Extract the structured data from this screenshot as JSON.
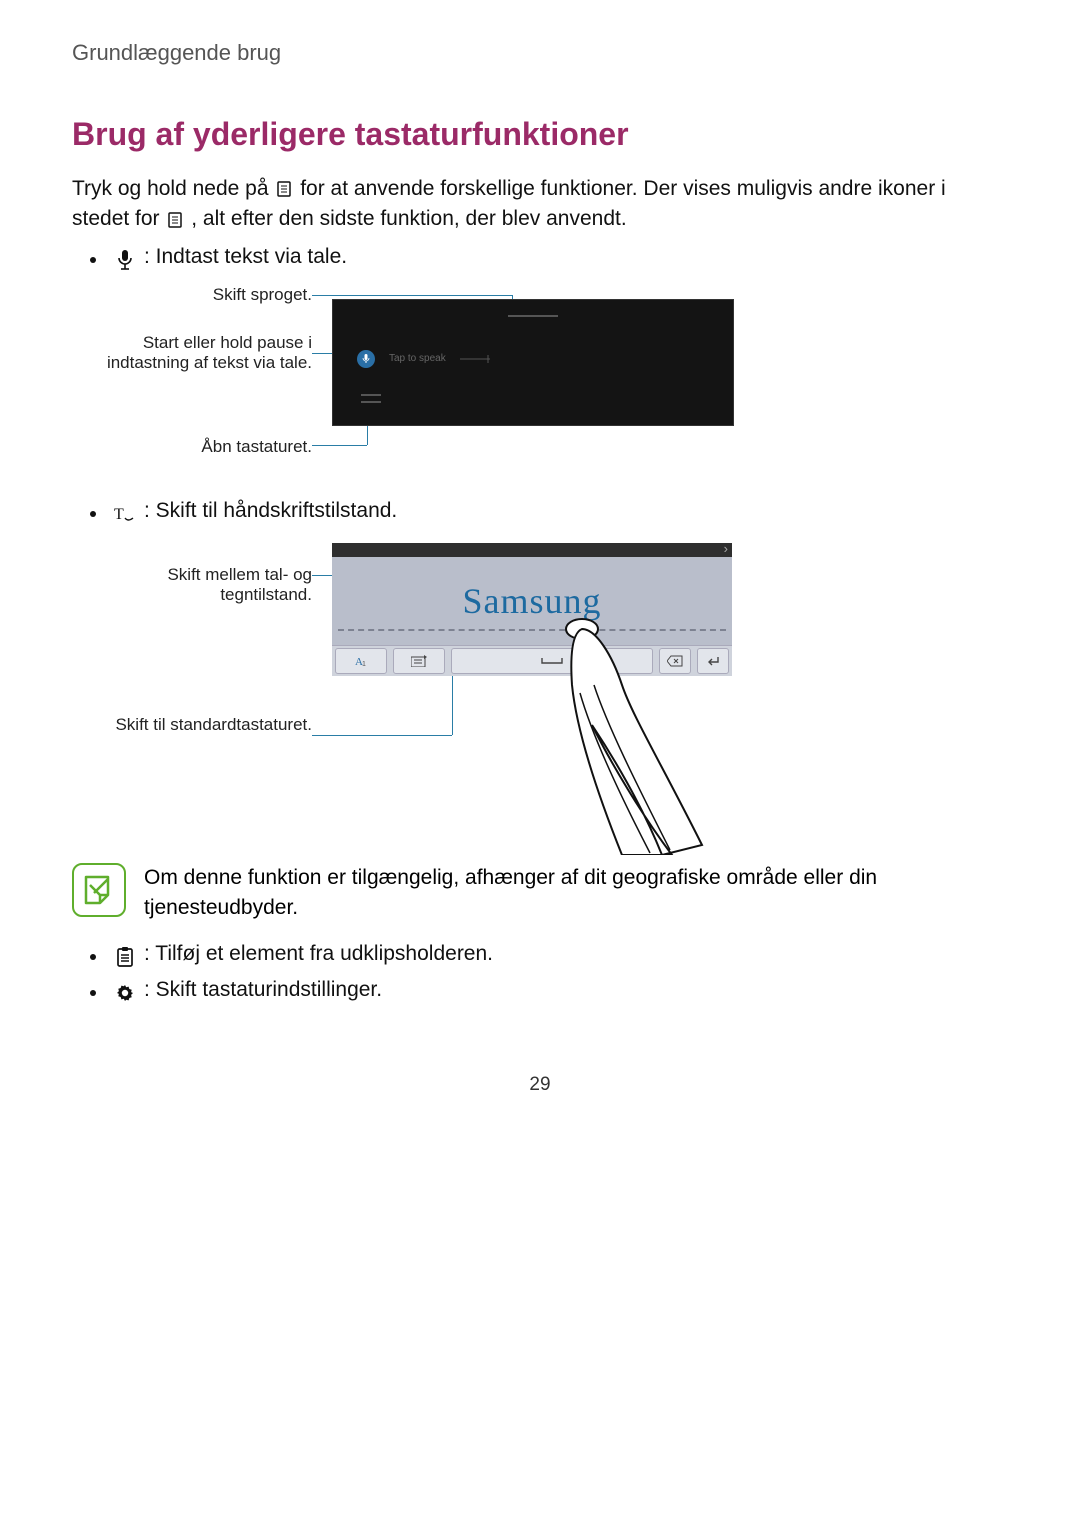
{
  "breadcrumb": "Grundlæggende brug",
  "heading": "Brug af yderligere tastaturfunktioner",
  "intro_a": "Tryk og hold nede på ",
  "intro_b": " for at anvende forskellige funktioner. Der vises muligvis andre ikoner i stedet for ",
  "intro_c": ", alt efter den sidste funktion, der blev anvendt.",
  "bullets": {
    "voice": " : Indtast tekst via tale.",
    "handwriting": " : Skift til håndskriftstilstand.",
    "clipboard": " : Tilføj et element fra udklipsholderen.",
    "settings": " : Skift tastaturindstillinger."
  },
  "fig1": {
    "callout_lang": "Skift sproget.",
    "callout_pause": "Start eller hold pause i indtastning af tekst via tale.",
    "callout_keyboard": "Åbn tastaturet.",
    "tap_prompt": "Tap to speak"
  },
  "fig2": {
    "callout_toggle": "Skift mellem tal- og tegntilstand.",
    "callout_std": "Skift til standardtastaturet.",
    "sample_text": "Samsung"
  },
  "note": "Om denne funktion er tilgængelig, afhænger af dit geografiske område eller din tjenesteudbyder.",
  "page_number": "29"
}
